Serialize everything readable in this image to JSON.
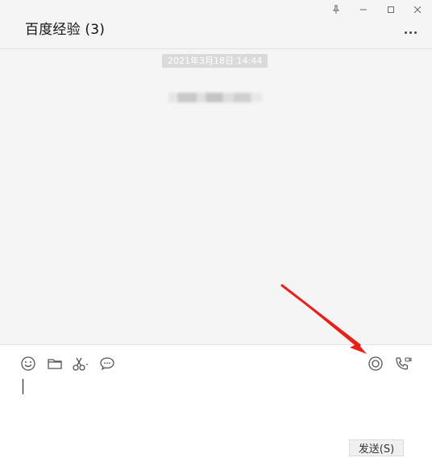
{
  "window": {
    "title": "百度经验 (3)"
  },
  "chat": {
    "timestamp": "2021年3月18日 14:44"
  },
  "toolbar": {
    "icons": [
      "emoji-icon",
      "folder-icon",
      "scissors-icon",
      "chat-history-icon",
      "live-icon",
      "video-call-icon"
    ]
  },
  "footer": {
    "send_label": "发送(S)"
  },
  "colors": {
    "accent_arrow": "#e8201a",
    "chat_bg": "#f5f5f5",
    "input_bg": "#ffffff"
  }
}
